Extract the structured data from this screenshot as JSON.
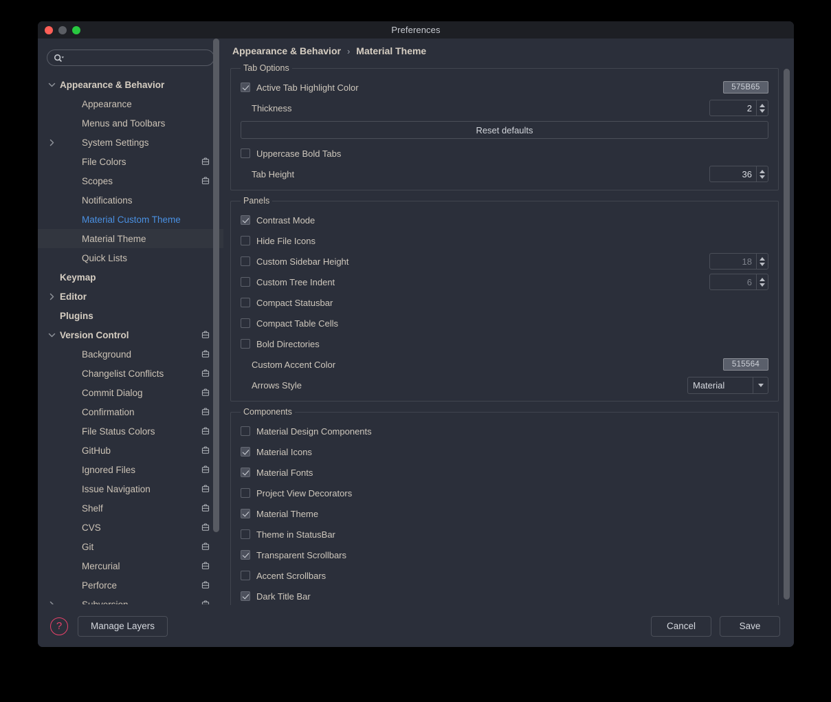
{
  "window": {
    "title": "Preferences",
    "traffic_lights": [
      "close-red",
      "minimize-yellow",
      "zoom-green"
    ]
  },
  "sidebar": {
    "search": {
      "value": "",
      "placeholder": ""
    },
    "items": [
      {
        "label": "Appearance & Behavior",
        "level": 0,
        "bold": true,
        "arrow": "down",
        "briefcase": false,
        "selected": false,
        "link": false
      },
      {
        "label": "Appearance",
        "level": 1,
        "bold": false,
        "arrow": "none",
        "briefcase": false,
        "selected": false,
        "link": false
      },
      {
        "label": "Menus and Toolbars",
        "level": 1,
        "bold": false,
        "arrow": "none",
        "briefcase": false,
        "selected": false,
        "link": false
      },
      {
        "label": "System Settings",
        "level": 1,
        "bold": false,
        "arrow": "right",
        "briefcase": false,
        "selected": false,
        "link": false
      },
      {
        "label": "File Colors",
        "level": 1,
        "bold": false,
        "arrow": "none",
        "briefcase": true,
        "selected": false,
        "link": false
      },
      {
        "label": "Scopes",
        "level": 1,
        "bold": false,
        "arrow": "none",
        "briefcase": true,
        "selected": false,
        "link": false
      },
      {
        "label": "Notifications",
        "level": 1,
        "bold": false,
        "arrow": "none",
        "briefcase": false,
        "selected": false,
        "link": false
      },
      {
        "label": "Material Custom Theme",
        "level": 1,
        "bold": false,
        "arrow": "none",
        "briefcase": false,
        "selected": false,
        "link": true
      },
      {
        "label": "Material Theme",
        "level": 1,
        "bold": false,
        "arrow": "none",
        "briefcase": false,
        "selected": true,
        "link": false
      },
      {
        "label": "Quick Lists",
        "level": 1,
        "bold": false,
        "arrow": "none",
        "briefcase": false,
        "selected": false,
        "link": false
      },
      {
        "label": "Keymap",
        "level": 0,
        "bold": true,
        "arrow": "none",
        "briefcase": false,
        "selected": false,
        "link": false
      },
      {
        "label": "Editor",
        "level": 0,
        "bold": true,
        "arrow": "right",
        "briefcase": false,
        "selected": false,
        "link": false
      },
      {
        "label": "Plugins",
        "level": 0,
        "bold": true,
        "arrow": "none",
        "briefcase": false,
        "selected": false,
        "link": false
      },
      {
        "label": "Version Control",
        "level": 0,
        "bold": true,
        "arrow": "down",
        "briefcase": true,
        "selected": false,
        "link": false
      },
      {
        "label": "Background",
        "level": 1,
        "bold": false,
        "arrow": "none",
        "briefcase": true,
        "selected": false,
        "link": false
      },
      {
        "label": "Changelist Conflicts",
        "level": 1,
        "bold": false,
        "arrow": "none",
        "briefcase": true,
        "selected": false,
        "link": false
      },
      {
        "label": "Commit Dialog",
        "level": 1,
        "bold": false,
        "arrow": "none",
        "briefcase": true,
        "selected": false,
        "link": false
      },
      {
        "label": "Confirmation",
        "level": 1,
        "bold": false,
        "arrow": "none",
        "briefcase": true,
        "selected": false,
        "link": false
      },
      {
        "label": "File Status Colors",
        "level": 1,
        "bold": false,
        "arrow": "none",
        "briefcase": true,
        "selected": false,
        "link": false
      },
      {
        "label": "GitHub",
        "level": 1,
        "bold": false,
        "arrow": "none",
        "briefcase": true,
        "selected": false,
        "link": false
      },
      {
        "label": "Ignored Files",
        "level": 1,
        "bold": false,
        "arrow": "none",
        "briefcase": true,
        "selected": false,
        "link": false
      },
      {
        "label": "Issue Navigation",
        "level": 1,
        "bold": false,
        "arrow": "none",
        "briefcase": true,
        "selected": false,
        "link": false
      },
      {
        "label": "Shelf",
        "level": 1,
        "bold": false,
        "arrow": "none",
        "briefcase": true,
        "selected": false,
        "link": false
      },
      {
        "label": "CVS",
        "level": 1,
        "bold": false,
        "arrow": "none",
        "briefcase": true,
        "selected": false,
        "link": false
      },
      {
        "label": "Git",
        "level": 1,
        "bold": false,
        "arrow": "none",
        "briefcase": true,
        "selected": false,
        "link": false
      },
      {
        "label": "Mercurial",
        "level": 1,
        "bold": false,
        "arrow": "none",
        "briefcase": true,
        "selected": false,
        "link": false
      },
      {
        "label": "Perforce",
        "level": 1,
        "bold": false,
        "arrow": "none",
        "briefcase": true,
        "selected": false,
        "link": false
      },
      {
        "label": "Subversion",
        "level": 1,
        "bold": false,
        "arrow": "right",
        "briefcase": true,
        "selected": false,
        "link": false
      }
    ]
  },
  "breadcrumb": {
    "parent": "Appearance & Behavior",
    "separator": "›",
    "current": "Material Theme"
  },
  "groups": [
    {
      "legend": "Tab Options",
      "rows": [
        {
          "kind": "checkbox-color",
          "label": "Active Tab Highlight Color",
          "checked": true,
          "color": "575B65"
        },
        {
          "kind": "label-spinner",
          "label": "Thickness",
          "value": "2",
          "disabled": false
        },
        {
          "kind": "button",
          "label": "Reset defaults"
        },
        {
          "kind": "checkbox",
          "label": "Uppercase Bold Tabs",
          "checked": false
        },
        {
          "kind": "label-spinner",
          "label": "Tab Height",
          "value": "36",
          "disabled": false
        }
      ]
    },
    {
      "legend": "Panels",
      "rows": [
        {
          "kind": "checkbox",
          "label": "Contrast Mode",
          "checked": true
        },
        {
          "kind": "checkbox",
          "label": "Hide File Icons",
          "checked": false
        },
        {
          "kind": "checkbox-spinner",
          "label": "Custom Sidebar Height",
          "checked": false,
          "value": "18",
          "disabled": true
        },
        {
          "kind": "checkbox-spinner",
          "label": "Custom Tree Indent",
          "checked": false,
          "value": "6",
          "disabled": true
        },
        {
          "kind": "checkbox",
          "label": "Compact Statusbar",
          "checked": false
        },
        {
          "kind": "checkbox",
          "label": "Compact Table Cells",
          "checked": false
        },
        {
          "kind": "checkbox",
          "label": "Bold Directories",
          "checked": false
        },
        {
          "kind": "label-color",
          "label": "Custom Accent Color",
          "color": "515564"
        },
        {
          "kind": "label-dropdown",
          "label": "Arrows Style",
          "value": "Material"
        }
      ]
    },
    {
      "legend": "Components",
      "rows": [
        {
          "kind": "checkbox",
          "label": "Material Design Components",
          "checked": false
        },
        {
          "kind": "checkbox",
          "label": "Material Icons",
          "checked": true
        },
        {
          "kind": "checkbox",
          "label": "Material Fonts",
          "checked": true
        },
        {
          "kind": "checkbox",
          "label": "Project View Decorators",
          "checked": false
        },
        {
          "kind": "checkbox",
          "label": "Material Theme",
          "checked": true
        },
        {
          "kind": "checkbox",
          "label": "Theme in StatusBar",
          "checked": false
        },
        {
          "kind": "checkbox",
          "label": "Transparent Scrollbars",
          "checked": true
        },
        {
          "kind": "checkbox",
          "label": "Accent Scrollbars",
          "checked": false
        },
        {
          "kind": "checkbox",
          "label": "Dark Title Bar",
          "checked": true
        }
      ]
    }
  ],
  "footer": {
    "help_glyph": "?",
    "manage_layers_label": "Manage Layers",
    "cancel_label": "Cancel",
    "save_label": "Save"
  },
  "colors": {
    "window_bg": "#2b2f3a",
    "titlebar_bg": "#1d1f24",
    "text": "#cfc8bd",
    "link": "#4a90e2",
    "selected_row": "#32363f",
    "accent_help": "#e8426a",
    "scrollbar": "#585b63"
  }
}
